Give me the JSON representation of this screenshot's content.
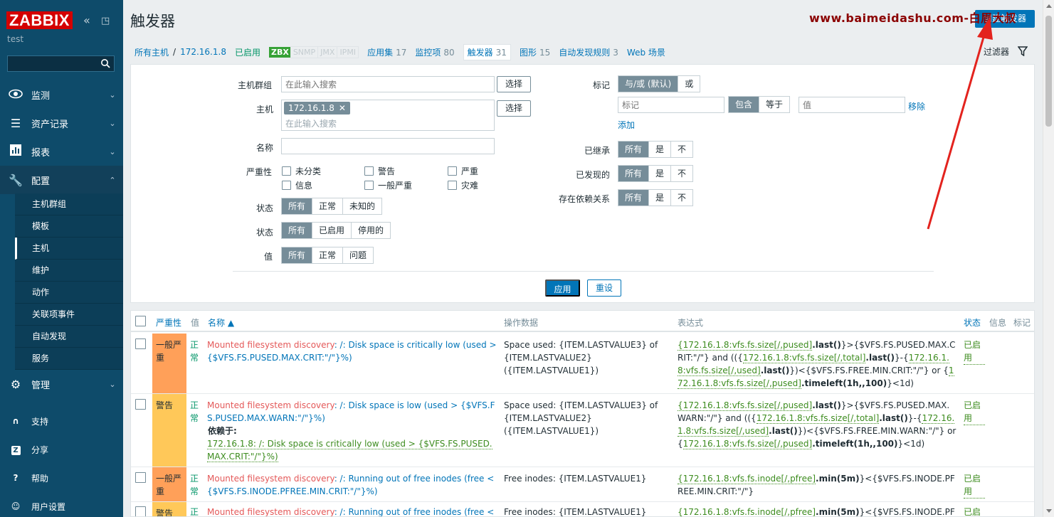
{
  "sidebar": {
    "logo": "ZABBIX",
    "subtitle": "test",
    "menu": [
      {
        "label": "监测",
        "icon": "eye-icon"
      },
      {
        "label": "资产记录",
        "icon": "list-icon"
      },
      {
        "label": "报表",
        "icon": "bar-chart-icon"
      },
      {
        "label": "配置",
        "icon": "wrench-icon"
      },
      {
        "label": "管理",
        "icon": "gear-icon"
      }
    ],
    "config_items": [
      "主机群组",
      "模板",
      "主机",
      "维护",
      "动作",
      "关联项事件",
      "自动发现",
      "服务"
    ],
    "utility": [
      {
        "label": "支持",
        "icon": "headset-icon"
      },
      {
        "label": "分享",
        "icon": "share-icon"
      },
      {
        "label": "帮助",
        "icon": "help-icon"
      },
      {
        "label": "用户设置",
        "icon": "user-icon"
      }
    ]
  },
  "header": {
    "title": "触发器",
    "watermark": "www.baimeidashu.com-白眉大叔",
    "create_button": "创建触发器"
  },
  "hostnav": {
    "all_hosts": "所有主机",
    "separator": "/",
    "host": "172.16.1.8",
    "enabled": "已启用",
    "badges": [
      "ZBX",
      "SNMP",
      "JMX",
      "IPMI"
    ],
    "tabs": [
      {
        "label": "应用集",
        "count": "17"
      },
      {
        "label": "监控项",
        "count": "80"
      },
      {
        "label": "触发器",
        "count": "31"
      },
      {
        "label": "图形",
        "count": "15"
      },
      {
        "label": "自动发现规则",
        "count": "3"
      },
      {
        "label": "Web 场景",
        "count": ""
      }
    ],
    "filter_label": "过滤器"
  },
  "filter": {
    "host_group_label": "主机群组",
    "search_placeholder": "在此输入搜索",
    "select_button": "选择",
    "host_label": "主机",
    "host_chip": "172.16.1.8",
    "name_label": "名称",
    "severity_label": "严重性",
    "severities": [
      "未分类",
      "警告",
      "严重",
      "信息",
      "一般严重",
      "灾难"
    ],
    "state_label": "状态",
    "state_options": [
      "所有",
      "正常",
      "未知的"
    ],
    "status_label": "状态",
    "status_options": [
      "所有",
      "已启用",
      "停用的"
    ],
    "value_label": "值",
    "value_options": [
      "所有",
      "正常",
      "问题"
    ],
    "tags_label": "标记",
    "tag_ops": [
      "与/或 (默认)",
      "或"
    ],
    "tag_placeholder": "标记",
    "tag_match": [
      "包含",
      "等于"
    ],
    "value_placeholder": "值",
    "remove_link": "移除",
    "add_link": "添加",
    "inherited_label": "已继承",
    "discovered_label": "已发现的",
    "dependency_label": "存在依赖关系",
    "yes_no": [
      "所有",
      "是",
      "不"
    ],
    "apply_button": "应用",
    "reset_button": "重设"
  },
  "table": {
    "headers": {
      "severity": "严重性",
      "value": "值",
      "name": "名称 ▲",
      "opdata": "操作数据",
      "expression": "表达式",
      "status": "状态",
      "info": "信息",
      "tags": "标记"
    },
    "rows": [
      {
        "severity": "一般严重",
        "value": "正常",
        "name_prefix": "Mounted filesystem discovery",
        "name": ": /: Disk space is critically low (used > {$VFS.FS.PUSED.MAX.CRIT:\"/\"}%)",
        "opdata": "Space used: {ITEM.LASTVALUE3} of {ITEM.LASTVALUE2} ({ITEM.LASTVALUE1})",
        "expr": [
          {
            "t": "l",
            "v": "{172.16.1.8:vfs.fs.size[/,pused]"
          },
          {
            "t": "f",
            "v": ".last()"
          },
          {
            "t": "p",
            "v": "}>{$VFS.FS.PUSED.MAX.CRIT:\"/\"} and (({"
          },
          {
            "t": "l",
            "v": "172.16.1.8:vfs.fs.size[/,total]"
          },
          {
            "t": "f",
            "v": ".last()"
          },
          {
            "t": "p",
            "v": "}-{"
          },
          {
            "t": "l",
            "v": "172.16.1.8:vfs.fs.size[/,used]"
          },
          {
            "t": "f",
            "v": ".last()"
          },
          {
            "t": "p",
            "v": "})<{$VFS.FS.FREE.MIN.CRIT:\"/\"} or {"
          },
          {
            "t": "l",
            "v": "172.16.1.8:vfs.fs.size[/,pused]"
          },
          {
            "t": "f",
            "v": ".timeleft(1h,,100)"
          },
          {
            "t": "p",
            "v": "}<1d)"
          }
        ],
        "status": "已启用"
      },
      {
        "severity": "警告",
        "value": "正常",
        "name_prefix": "Mounted filesystem discovery",
        "name": ": /: Disk space is low (used > {$VFS.FS.PUSED.MAX.WARN:\"/\"}%)",
        "depends_label": "依赖于:",
        "depends": "172.16.1.8: /: Disk space is critically low (used > {$VFS.FS.PUSED.MAX.CRIT:\"/\"}%)",
        "opdata": "Space used: {ITEM.LASTVALUE3} of {ITEM.LASTVALUE2} ({ITEM.LASTVALUE1})",
        "expr": [
          {
            "t": "l",
            "v": "{172.16.1.8:vfs.fs.size[/,pused]"
          },
          {
            "t": "f",
            "v": ".last()"
          },
          {
            "t": "p",
            "v": "}>{$VFS.FS.PUSED.MAX.WARN:\"/\"} and (({"
          },
          {
            "t": "l",
            "v": "172.16.1.8:vfs.fs.size[/,total]"
          },
          {
            "t": "f",
            "v": ".last()"
          },
          {
            "t": "p",
            "v": "}-{"
          },
          {
            "t": "l",
            "v": "172.16.1.8:vfs.fs.size[/,used]"
          },
          {
            "t": "f",
            "v": ".last()"
          },
          {
            "t": "p",
            "v": "})<{$VFS.FS.FREE.MIN.WARN:\"/\"} or {"
          },
          {
            "t": "l",
            "v": "172.16.1.8:vfs.fs.size[/,pused]"
          },
          {
            "t": "f",
            "v": ".timeleft(1h,,100)"
          },
          {
            "t": "p",
            "v": "}<1d)"
          }
        ],
        "status": "已启用"
      },
      {
        "severity": "一般严重",
        "value": "正常",
        "name_prefix": "Mounted filesystem discovery",
        "name": ": /: Running out of free inodes (free < {$VFS.FS.INODE.PFREE.MIN.CRIT:\"/\"}%)",
        "opdata": "Free inodes: {ITEM.LASTVALUE1}",
        "expr": [
          {
            "t": "l",
            "v": "{172.16.1.8:vfs.fs.inode[/,pfree]"
          },
          {
            "t": "f",
            "v": ".min(5m)"
          },
          {
            "t": "p",
            "v": "}<{$VFS.FS.INODE.PFREE.MIN.CRIT:\"/\"}"
          }
        ],
        "status": "已启用"
      },
      {
        "severity": "警告",
        "value": "正常",
        "name_prefix": "Mounted filesystem discovery",
        "name": ": /: Running out of free inodes (free < {$VFS.F",
        "opdata": "Free inodes: {ITEM.LASTVALUE1}",
        "expr": [
          {
            "t": "l",
            "v": "{172.16.1.8:vfs.fs.inode[/,pfree]"
          },
          {
            "t": "f",
            "v": ".min(5m)"
          },
          {
            "t": "p",
            "v": "}<{$VFS.FS.INODE.PFREE.MIN."
          }
        ],
        "status": "已启"
      }
    ]
  }
}
